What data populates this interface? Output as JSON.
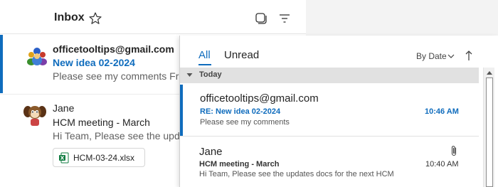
{
  "left_pane": {
    "header": {
      "title": "Inbox"
    },
    "messages": [
      {
        "sender": "officetooltips@gmail.com",
        "subject": "New idea 02-2024",
        "preview": "Please see my comments Fro",
        "selected": true
      },
      {
        "sender": "Jane",
        "subject": "HCM meeting - March",
        "preview": "Hi Team, Please see the upda",
        "attachment": "HCM-03-24.xlsx"
      }
    ]
  },
  "right_pane": {
    "tabs": {
      "all": "All",
      "unread": "Unread"
    },
    "sort": {
      "label": "By Date"
    },
    "group": {
      "label": "Today"
    },
    "messages": [
      {
        "sender": "officetooltips@gmail.com",
        "subject": "RE: New idea 02-2024",
        "preview": "Please see my comments",
        "time": "10:46 AM",
        "unread": true
      },
      {
        "sender": "Jane",
        "subject": "HCM meeting - March",
        "preview": "Hi Team,  Please see the updates docs for the next HCM",
        "time": "10:40 AM",
        "has_attachment": true
      }
    ]
  },
  "colors": {
    "accent": "#0f6cbd",
    "excel_green": "#107c41"
  }
}
